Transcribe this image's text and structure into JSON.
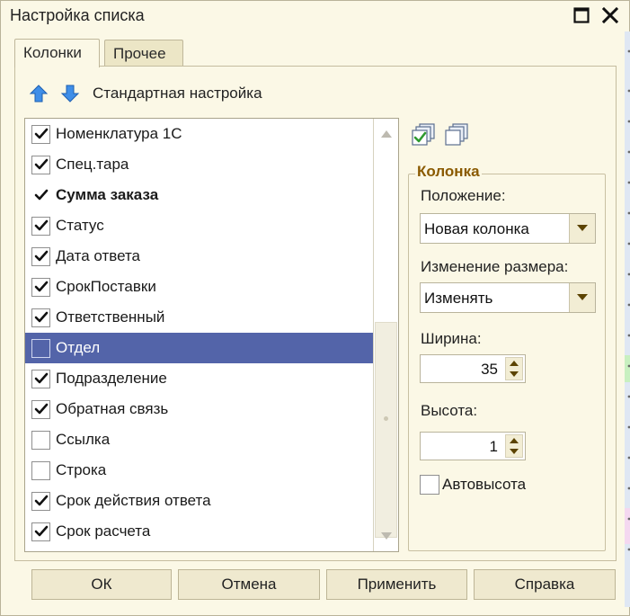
{
  "window": {
    "title": "Настройка списка"
  },
  "tabs": [
    {
      "label": "Колонки",
      "active": true
    },
    {
      "label": "Прочее",
      "active": false
    }
  ],
  "toolbar": {
    "standard_label": "Стандартная настройка"
  },
  "columns": [
    {
      "label": "Номенклатура 1С",
      "checked": true,
      "bold": false
    },
    {
      "label": "Спец.тара",
      "checked": true,
      "bold": false
    },
    {
      "label": "Сумма заказа",
      "checked": true,
      "bold": true
    },
    {
      "label": "Статус",
      "checked": true,
      "bold": false
    },
    {
      "label": "Дата ответа",
      "checked": true,
      "bold": false
    },
    {
      "label": "СрокПоставки",
      "checked": true,
      "bold": false
    },
    {
      "label": "Ответственный",
      "checked": true,
      "bold": false
    },
    {
      "label": "Отдел",
      "checked": false,
      "bold": false,
      "selected": true
    },
    {
      "label": "Подразделение",
      "checked": true,
      "bold": false
    },
    {
      "label": "Обратная связь",
      "checked": true,
      "bold": false
    },
    {
      "label": "Ссылка",
      "checked": false,
      "bold": false
    },
    {
      "label": "Строка",
      "checked": false,
      "bold": false
    },
    {
      "label": "Срок действия ответа",
      "checked": true,
      "bold": false
    },
    {
      "label": "Срок расчета",
      "checked": true,
      "bold": false
    }
  ],
  "column_group": {
    "title": "Колонка",
    "position_label": "Положение:",
    "position_value": "Новая колонка",
    "resize_label": "Изменение размера:",
    "resize_value": "Изменять",
    "width_label": "Ширина:",
    "width_value": "35",
    "height_label": "Высота:",
    "height_value": "1",
    "autoheight_label": "Автовысота",
    "autoheight_checked": false
  },
  "buttons": {
    "ok": "ОК",
    "cancel": "Отмена",
    "apply": "Применить",
    "help": "Справка"
  },
  "colors": {
    "window_bg": "#fbf8e6",
    "selection": "#5364a9",
    "group_title": "#8a5a00"
  }
}
